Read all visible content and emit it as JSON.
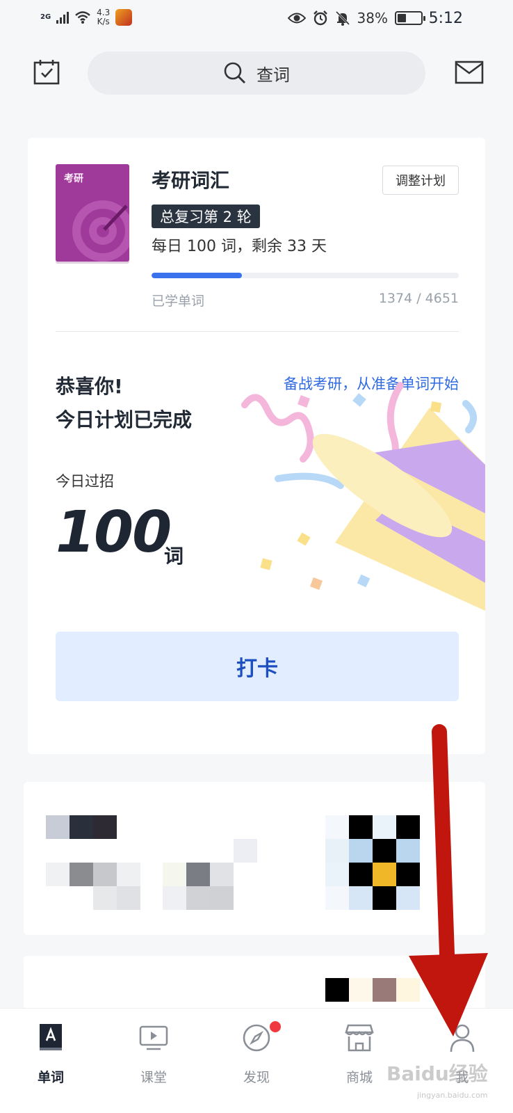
{
  "status_bar": {
    "network": "2G",
    "speed_value": "4.3",
    "speed_unit": "K/s",
    "battery": "38%",
    "time": "5:12"
  },
  "top_bar": {
    "search_placeholder": "查词"
  },
  "plan_card": {
    "book_cover_label": "考研",
    "book_title": "考研词汇",
    "adjust_plan_label": "调整计划",
    "round_badge": "总复习第 2 轮",
    "daily_plan": "每日 100 词，剩余 33 天",
    "progress_fraction": 0.295,
    "learned_label": "已学单词",
    "learned_count": "1374 / 4651",
    "congrats_line1": "恭喜你!",
    "congrats_line2": "今日计划已完成",
    "slogan": "备战考研，从准备单词开始",
    "today_label": "今日过招",
    "today_count": "100",
    "today_unit": "词",
    "checkin_label": "打卡"
  },
  "tabs": [
    {
      "label": "单词",
      "icon": "word-book-icon",
      "active": true
    },
    {
      "label": "课堂",
      "icon": "video-play-icon",
      "active": false
    },
    {
      "label": "发现",
      "icon": "compass-icon",
      "active": false
    },
    {
      "label": "商城",
      "icon": "store-icon",
      "active": false
    },
    {
      "label": "我",
      "icon": "user-icon",
      "active": false
    }
  ],
  "colors": {
    "accent_blue": "#3a72ee",
    "checkin_bg": "#e2eeff",
    "badge_dark": "#2a3340",
    "book_purple": "#a03a9a",
    "notification_red": "#f0393e",
    "annotation_arrow": "#c0160e"
  },
  "watermark": {
    "text": "Baidu经验",
    "url_text": "jingyan.baidu.com"
  }
}
